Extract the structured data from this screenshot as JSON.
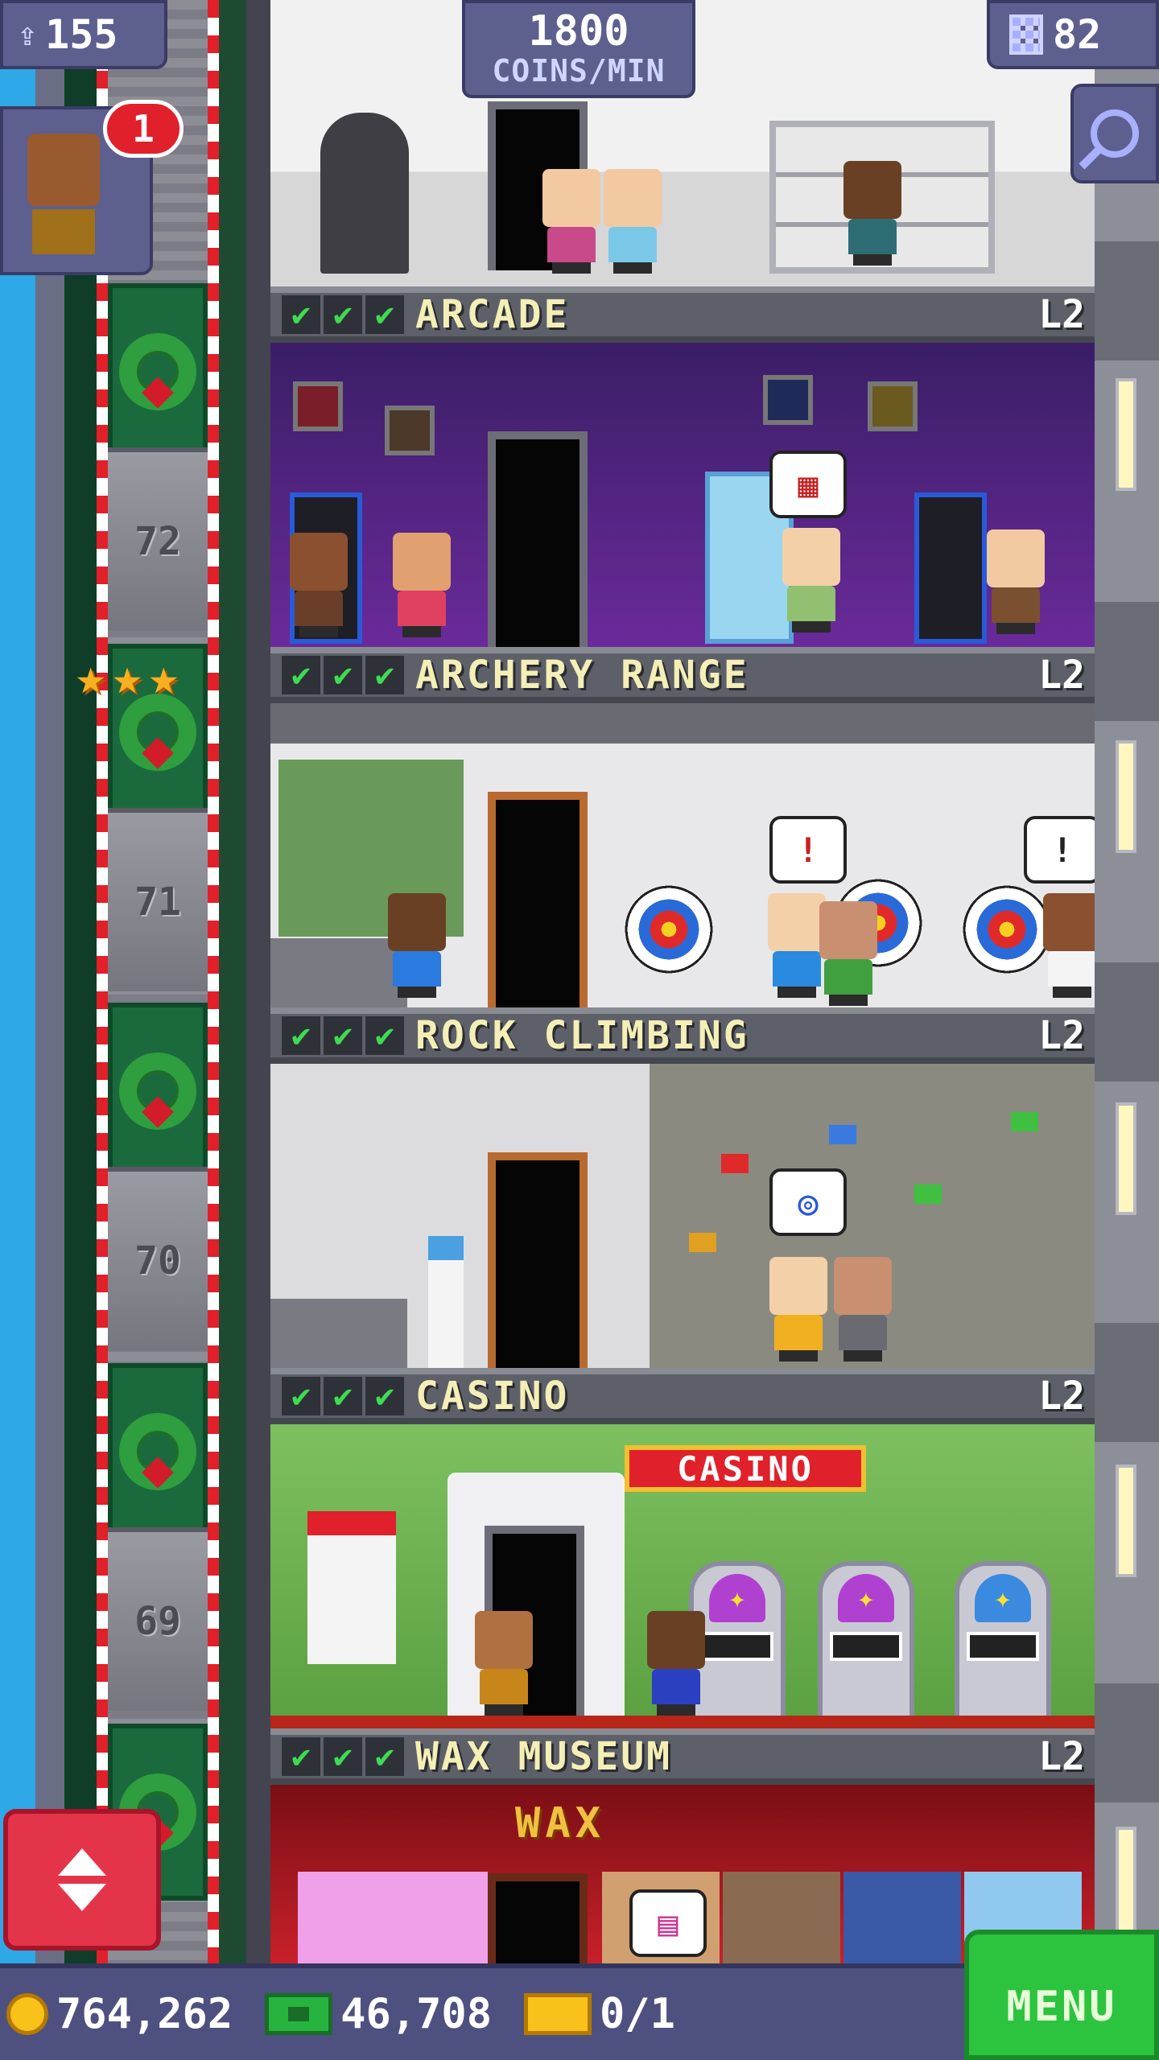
{
  "hud": {
    "population": "155",
    "rate_value": "1800",
    "rate_unit": "COINS/MIN",
    "floor_count": "82",
    "visitor_badge": "1"
  },
  "elevator": {
    "floor_numbers": [
      "72",
      "71",
      "70",
      "69"
    ],
    "rating_stars": 3
  },
  "floors": [
    {
      "name": "ARCADE",
      "level": "L2",
      "checks": 3
    },
    {
      "name": "ARCHERY RANGE",
      "level": "L2",
      "checks": 3
    },
    {
      "name": "ROCK CLIMBING",
      "level": "L2",
      "checks": 3
    },
    {
      "name": "CASINO",
      "level": "L2",
      "checks": 3
    },
    {
      "name": "WAX MUSEUM",
      "level": "L2",
      "checks": 3
    }
  ],
  "signs": {
    "casino": "CASINO",
    "wax": "WAX"
  },
  "bottom_bar": {
    "coins": "764,262",
    "bux": "46,708",
    "tickets": "0/1",
    "menu_label": "MENU"
  },
  "colors": {
    "hud_panel": "#5d5f8e",
    "menu_green": "#2cc33f",
    "elevator_red": "#e4344a",
    "label_text": "#f4efb6",
    "check_green": "#3ddc52"
  },
  "icons": [
    "population-icon",
    "floors-icon",
    "zoom-icon",
    "coin-icon",
    "bux-icon",
    "ticket-icon",
    "elevator-arrows-icon",
    "wreath-icon",
    "star-icon",
    "check-icon"
  ]
}
